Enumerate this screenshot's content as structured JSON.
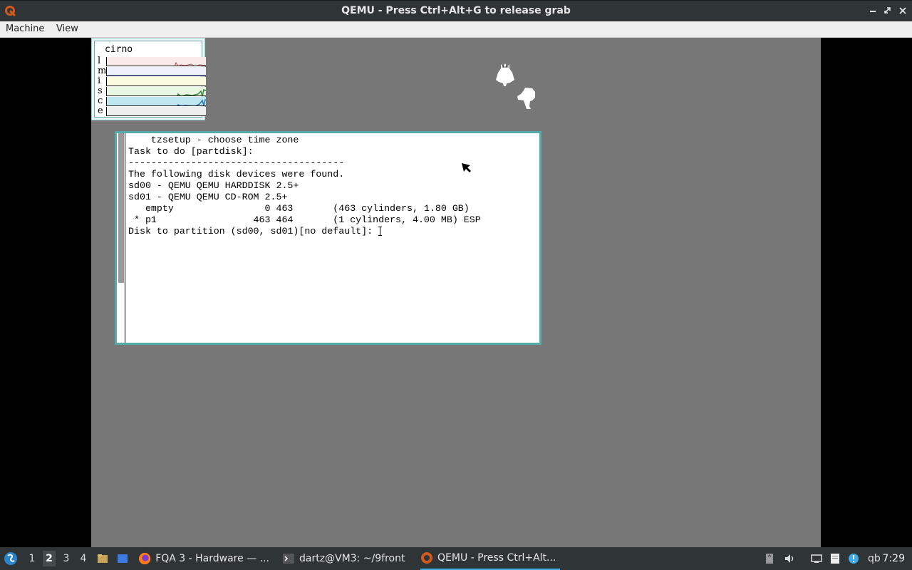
{
  "window": {
    "title": "QEMU - Press Ctrl+Alt+G to release grab",
    "controls": [
      "minimize-icon",
      "maximize-icon",
      "close-icon"
    ]
  },
  "menubar": {
    "items": [
      "Machine",
      "View"
    ]
  },
  "vm": {
    "stats": {
      "label": "cirno",
      "rows": [
        "l",
        "m",
        "i",
        "s",
        "c",
        "e"
      ]
    },
    "terminal": {
      "lines": [
        "    tzsetup - choose time zone",
        "",
        "Task to do [partdisk]:",
        "",
        "--------------------------------------",
        "The following disk devices were found.",
        "",
        "sd00 - QEMU QEMU HARDDISK 2.5+",
        "",
        "sd01 - QEMU QEMU CD-ROM 2.5+",
        "   empty                0 463       (463 cylinders, 1.80 GB)",
        " * p1                 463 464       (1 cylinders, 4.00 MB) ESP",
        "",
        "Disk to partition (sd00, sd01)[no default]: "
      ]
    }
  },
  "taskbar": {
    "workspaces": [
      "1",
      "2",
      "3",
      "4"
    ],
    "active_workspace": "2",
    "tasks": [
      {
        "label": "FQA 3 - Hardware — ...",
        "icon": "firefox-icon"
      },
      {
        "label": "dartz@VM3: ~/9front",
        "icon": "terminal-icon"
      },
      {
        "label": "QEMU - Press Ctrl+Alt...",
        "icon": "qemu-icon"
      }
    ],
    "clock": "7:29",
    "tray_text": "qb"
  },
  "colors": {
    "chrome": "#2f3437",
    "vm_background": "#777777",
    "window_border": "#55aaaa",
    "accent": "#3daee9"
  }
}
